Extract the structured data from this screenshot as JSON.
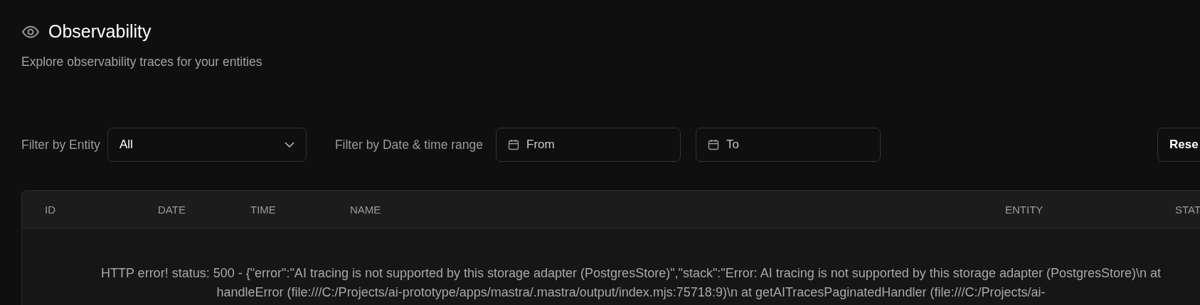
{
  "header": {
    "title": "Observability",
    "subtitle": "Explore observability traces for your entities"
  },
  "filters": {
    "entity_label": "Filter by Entity",
    "entity_value": "All",
    "date_label": "Filter by Date & time range",
    "from_placeholder": "From",
    "to_placeholder": "To",
    "reset_button": "Rese"
  },
  "table": {
    "columns": [
      "ID",
      "DATE",
      "TIME",
      "NAME",
      "ENTITY",
      "STAT"
    ],
    "error_lines": [
      "HTTP error! status: 500 - {\"error\":\"AI tracing is not supported by this storage adapter (PostgresStore)\",\"stack\":\"Error: AI tracing is not supported by this storage adapter (PostgresStore)\\n at",
      "handleError (file:///C:/Projects/ai-prototype/apps/mastra/.mastra/output/index.mjs:75718:9)\\n at getAITracesPaginatedHandler (file:///C:/Projects/ai-"
    ]
  }
}
